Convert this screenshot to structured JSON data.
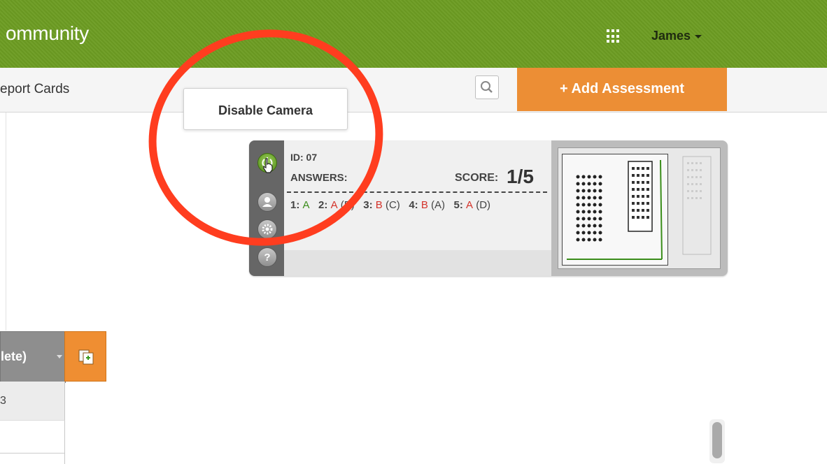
{
  "header": {
    "brand": "ommunity",
    "user": "James"
  },
  "subnav": {
    "link": "eport Cards",
    "add_button": "+ Add Assessment"
  },
  "tooltip": {
    "text": "Disable Camera"
  },
  "card": {
    "id_label": "ID: 07",
    "answers_label": "ANSWERS:",
    "score_label": "SCORE:",
    "score": "1/5",
    "answers": [
      {
        "num": "1:",
        "given": "A",
        "given_status": "correct",
        "expected": ""
      },
      {
        "num": "2:",
        "given": "A",
        "given_status": "wrong",
        "expected": "(B)"
      },
      {
        "num": "3:",
        "given": "B",
        "given_status": "wrong",
        "expected": "(C)"
      },
      {
        "num": "4:",
        "given": "B",
        "given_status": "wrong",
        "expected": "(A)"
      },
      {
        "num": "5:",
        "given": "A",
        "given_status": "wrong",
        "expected": "(D)"
      }
    ],
    "side_buttons": [
      "power-icon",
      "user-icon",
      "settings-icon",
      "help-icon"
    ]
  },
  "table": {
    "header": "lete)",
    "row1": "3"
  },
  "colors": {
    "topbar": "#6c9c22",
    "accent": "#ec8e35",
    "highlight_ring": "#ff3d1f",
    "correct": "#3b8d1b",
    "wrong": "#d4332a"
  }
}
